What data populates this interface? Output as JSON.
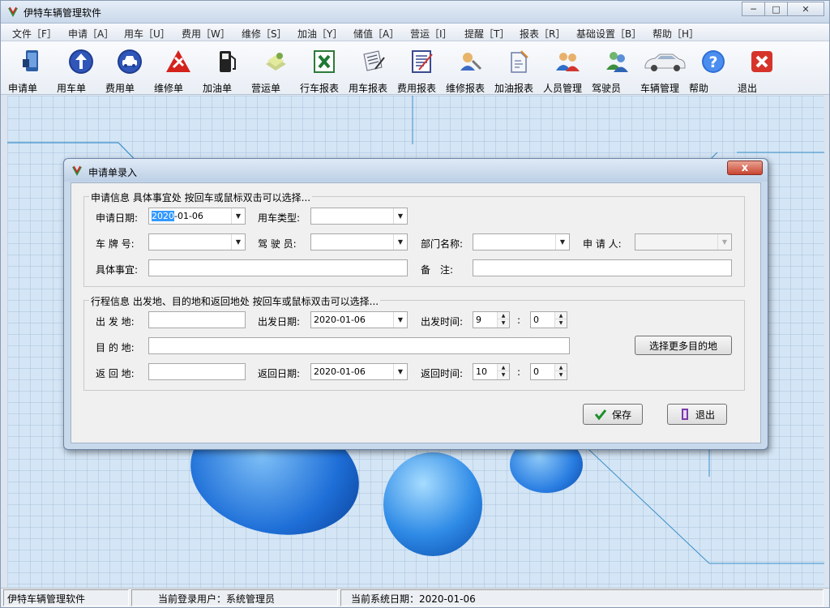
{
  "window": {
    "title": "伊特车辆管理软件",
    "controls": {
      "minimize": "─",
      "maximize": "□",
      "close": "✕"
    }
  },
  "menu": [
    "文件［F］",
    "申请［A］",
    "用车［U］",
    "费用［W］",
    "维修［S］",
    "加油［Y］",
    "储值［A］",
    "营运［I］",
    "提醒［T］",
    "报表［R］",
    "基础设置［B］",
    "帮助［H］"
  ],
  "toolbar": [
    {
      "label": "申请单",
      "icon": "application-form-icon"
    },
    {
      "label": "用车单",
      "icon": "arrow-up-circle-icon"
    },
    {
      "label": "费用单",
      "icon": "car-cost-icon"
    },
    {
      "label": "维修单",
      "icon": "repair-warning-icon"
    },
    {
      "label": "加油单",
      "icon": "fuel-pump-icon"
    },
    {
      "label": "营运单",
      "icon": "operation-doc-icon"
    },
    {
      "label": "行车报表",
      "icon": "excel-report-icon"
    },
    {
      "label": "用车报表",
      "icon": "usage-report-icon"
    },
    {
      "label": "费用报表",
      "icon": "cost-report-icon"
    },
    {
      "label": "维修报表",
      "icon": "repair-report-icon"
    },
    {
      "label": "加油报表",
      "icon": "fuel-report-icon"
    },
    {
      "label": "人员管理",
      "icon": "people-icon"
    },
    {
      "label": "驾驶员",
      "icon": "driver-icon"
    },
    {
      "label": "车辆管理",
      "icon": "car-icon"
    },
    {
      "label": "帮助",
      "icon": "help-icon"
    },
    {
      "label": "退出",
      "icon": "exit-icon"
    }
  ],
  "status": {
    "app": "伊特车辆管理软件",
    "user_label": "当前登录用户：",
    "user": "系统管理员",
    "date_label": "当前系统日期：",
    "date": "2020-01-06"
  },
  "dialog": {
    "title": "申请单录入",
    "close": "x",
    "group1": {
      "caption": "申请信息 具体事宜处 按回车或鼠标双击可以选择...",
      "apply_date_label": "申请日期:",
      "apply_date_selected": "2020",
      "apply_date_rest": "-01-06",
      "car_type_label": "用车类型:",
      "car_type": "",
      "plate_label": "车 牌 号:",
      "plate": "",
      "driver_label": "驾 驶 员:",
      "driver": "",
      "dept_label": "部门名称:",
      "dept": "",
      "applicant_label": "申 请 人:",
      "applicant": "",
      "matter_label": "具体事宜:",
      "matter": "",
      "remark_label": "备　注:",
      "remark": ""
    },
    "group2": {
      "caption": "行程信息 出发地、目的地和返回地处 按回车或鼠标双击可以选择...",
      "depart_place_label": "出 发 地:",
      "depart_place": "",
      "depart_date_label": "出发日期:",
      "depart_date": "2020-01-06",
      "depart_time_label": "出发时间:",
      "depart_hour": "9",
      "depart_min": "0",
      "dest_label": "目 的 地:",
      "dest": "",
      "more_dest_button": "选择更多目的地",
      "return_place_label": "返 回 地:",
      "return_place": "",
      "return_date_label": "返回日期:",
      "return_date": "2020-01-06",
      "return_time_label": "返回时间:",
      "return_hour": "10",
      "return_min": "0",
      "colon": ":"
    },
    "save_button": "保存",
    "exit_button": "退出"
  },
  "colors": {
    "accent_selection": "#3399ff",
    "desktop_bg": "#d4e5f5",
    "title_bar": "#c9d8ea"
  }
}
